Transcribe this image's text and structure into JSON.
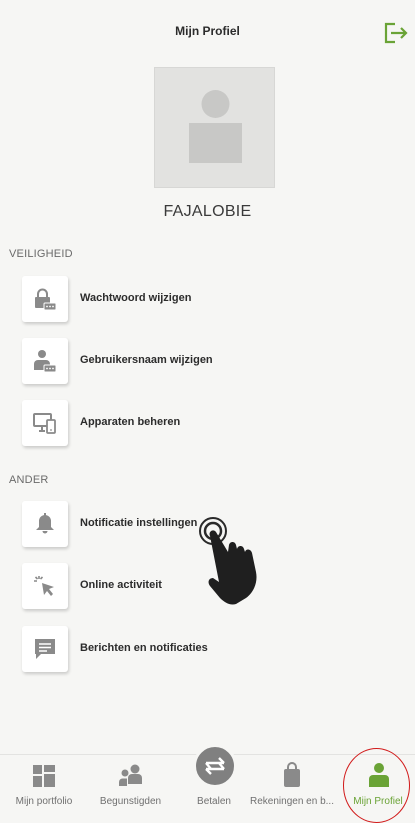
{
  "header": {
    "title": "Mijn Profiel",
    "logout_icon": "logout-icon"
  },
  "profile": {
    "avatar_icon": "user-avatar-placeholder",
    "username": "FAJALOBIE"
  },
  "sections": {
    "security": {
      "label": "VEILIGHEID",
      "items": [
        {
          "label": "Wachtwoord wijzigen",
          "icon": "lock-password-icon"
        },
        {
          "label": "Gebruikersnaam wijzigen",
          "icon": "user-password-icon"
        },
        {
          "label": "Apparaten beheren",
          "icon": "devices-icon"
        }
      ]
    },
    "other": {
      "label": "ANDER",
      "items": [
        {
          "label": "Notificatie instellingen",
          "icon": "bell-icon"
        },
        {
          "label": "Online activiteit",
          "icon": "cursor-click-icon"
        },
        {
          "label": "Berichten en notificaties",
          "icon": "message-icon"
        }
      ]
    }
  },
  "bottom_nav": [
    {
      "label": "Mijn portfolio",
      "icon": "portfolio-icon"
    },
    {
      "label": "Begunstigden",
      "icon": "beneficiaries-icon"
    },
    {
      "label": "Betalen",
      "icon": "transfer-icon"
    },
    {
      "label": "Rekeningen en b...",
      "icon": "bag-icon"
    },
    {
      "label": "Mijn Profiel",
      "icon": "profile-icon",
      "active": true
    }
  ],
  "colors": {
    "accent": "#6aa336",
    "icon_gray": "#8a8a8a",
    "background": "#f6f6f4",
    "highlight": "#d11a1a"
  }
}
